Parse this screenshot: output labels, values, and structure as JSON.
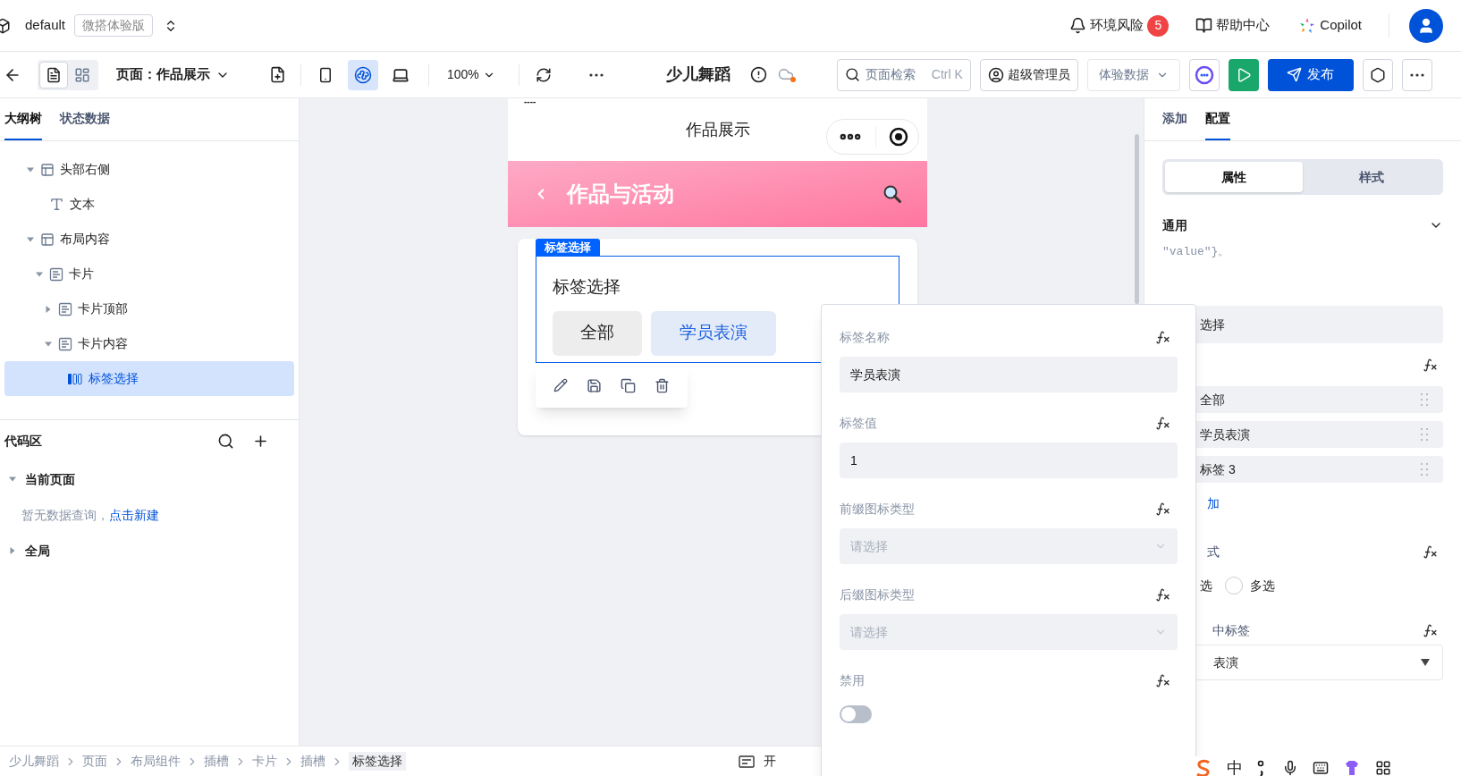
{
  "header": {
    "workspace": "default",
    "edition": "微搭体验版",
    "risk": {
      "label": "环境风险",
      "count": "5"
    },
    "help": "帮助中心",
    "copilot": "Copilot"
  },
  "toolbar": {
    "view_modes": [
      {
        "kind": "outline",
        "selected": true
      },
      {
        "kind": "grid",
        "selected": false
      }
    ],
    "page_label": "页面：作品展示",
    "devices": [
      {
        "kind": "phone",
        "selected": false
      },
      {
        "kind": "miniprogram",
        "selected": true
      },
      {
        "kind": "desktop",
        "selected": false
      }
    ],
    "zoom": "100%",
    "app_name": "少儿舞蹈",
    "search": {
      "placeholder": "页面检索",
      "shortcut": "Ctrl K"
    },
    "role": "超级管理员",
    "data_source": "体验数据",
    "publish": "发布"
  },
  "left_panel": {
    "tabs": [
      {
        "label": "大纲树",
        "selected": true
      },
      {
        "label": "状态数据",
        "selected": false
      }
    ],
    "tree": [
      {
        "label": "头部右侧",
        "kind": "layout",
        "expanded": true,
        "selected": false,
        "children": [
          {
            "label": "文本",
            "kind": "text",
            "selected": false
          }
        ]
      },
      {
        "label": "布局内容",
        "kind": "layout",
        "expanded": true,
        "selected": false,
        "children": [
          {
            "label": "卡片",
            "kind": "card",
            "expanded": true,
            "selected": false,
            "children": [
              {
                "label": "卡片顶部",
                "kind": "card",
                "expanded": false,
                "selected": false
              },
              {
                "label": "卡片内容",
                "kind": "card",
                "expanded": true,
                "selected": false,
                "children": [
                  {
                    "label": "标签选择",
                    "kind": "tags",
                    "selected": true
                  }
                ]
              }
            ]
          }
        ]
      }
    ],
    "code_area": {
      "title": "代码区",
      "groups": [
        {
          "label": "当前页面",
          "expanded": true,
          "empty_text": "暂无数据查询，",
          "link": "点击新建"
        },
        {
          "label": "全局",
          "expanded": false
        }
      ]
    }
  },
  "canvas": {
    "marker": "----",
    "page_title": "作品展示",
    "banner_title": "作品与活动",
    "component_label": "标签选择",
    "tag_select": {
      "title": "标签选择",
      "tags": [
        {
          "label": "全部",
          "selected": false
        },
        {
          "label": "学员表演",
          "selected": true
        }
      ]
    }
  },
  "popover": {
    "fields": [
      {
        "kind": "input",
        "label": "标签名称",
        "value": "学员表演"
      },
      {
        "kind": "input",
        "label": "标签值",
        "value": "1"
      },
      {
        "kind": "select",
        "label": "前缀图标类型",
        "placeholder": "请选择"
      },
      {
        "kind": "select",
        "label": "后缀图标类型",
        "placeholder": "请选择"
      },
      {
        "kind": "switch",
        "label": "禁用",
        "on": false
      }
    ]
  },
  "right_panel": {
    "tabs": [
      {
        "label": "添加",
        "selected": false
      },
      {
        "label": "配置",
        "selected": true
      }
    ],
    "segments": [
      {
        "label": "属性",
        "selected": true
      },
      {
        "label": "样式",
        "selected": false
      }
    ],
    "section": "通用",
    "hint": "″value″}。",
    "title_value": "选择",
    "options": [
      "全部",
      "学员表演",
      "标签 3"
    ],
    "add_link": "加",
    "mode_label": "式",
    "mode_option": "选",
    "modes": [
      {
        "label": "多选",
        "selected": false
      }
    ],
    "selected_label": "中标签",
    "selected_value": "表演"
  },
  "breadcrumb": [
    "少儿舞蹈",
    "页面",
    "布局组件",
    "插槽",
    "卡片",
    "插槽",
    "标签选择"
  ],
  "status_item": "开",
  "ime": {
    "label": "中"
  }
}
